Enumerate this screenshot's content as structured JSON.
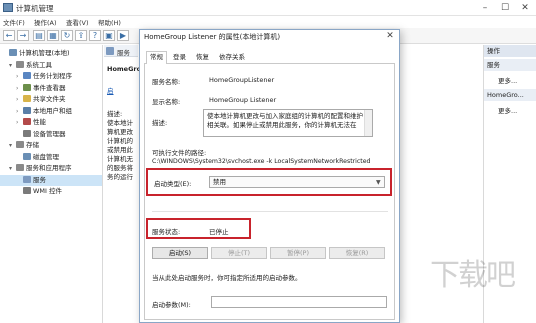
{
  "main": {
    "title": "计算机管理",
    "menu": [
      "文件(F)",
      "操作(A)",
      "查看(V)",
      "帮助(H)"
    ]
  },
  "tree": [
    {
      "label": "计算机管理(本地)",
      "indent": 0,
      "exp": "",
      "icon": "computer-icon",
      "color": "#6a8fb5"
    },
    {
      "label": "系统工具",
      "indent": 1,
      "exp": "▾",
      "icon": "tools-icon",
      "color": "#8a8a8a"
    },
    {
      "label": "任务计划程序",
      "indent": 2,
      "exp": "›",
      "icon": "clock-icon",
      "color": "#5a86c2"
    },
    {
      "label": "事件查看器",
      "indent": 2,
      "exp": "›",
      "icon": "event-viewer-icon",
      "color": "#6c8f4a"
    },
    {
      "label": "共享文件夹",
      "indent": 2,
      "exp": "›",
      "icon": "folder-icon",
      "color": "#d8b44a"
    },
    {
      "label": "本地用户和组",
      "indent": 2,
      "exp": "›",
      "icon": "users-icon",
      "color": "#5a7fa8"
    },
    {
      "label": "性能",
      "indent": 2,
      "exp": "›",
      "icon": "performance-icon",
      "color": "#b34a4a"
    },
    {
      "label": "设备管理器",
      "indent": 2,
      "exp": "",
      "icon": "device-icon",
      "color": "#7a7a7a"
    },
    {
      "label": "存储",
      "indent": 1,
      "exp": "▾",
      "icon": "storage-icon",
      "color": "#8a8a8a"
    },
    {
      "label": "磁盘管理",
      "indent": 2,
      "exp": "",
      "icon": "disk-icon",
      "color": "#6a8fb5"
    },
    {
      "label": "服务和应用程序",
      "indent": 1,
      "exp": "▾",
      "icon": "services-apps-icon",
      "color": "#8a8a8a"
    },
    {
      "label": "服务",
      "indent": 2,
      "exp": "",
      "icon": "gear-icon",
      "color": "#7d9ac0",
      "selected": true
    },
    {
      "label": "WMI 控件",
      "indent": 2,
      "exp": "",
      "icon": "wmi-icon",
      "color": "#7a7a7a"
    }
  ],
  "center": {
    "header": "服务",
    "name1": "HomeGro",
    "link": "启",
    "desc_lines": [
      "描述:",
      "使本地计",
      "算机更改",
      "计算机的",
      "或禁用此",
      "计算机无",
      "的服务将",
      "务的运行"
    ]
  },
  "actions": {
    "header1": "操作",
    "section1": "服务",
    "more1": "更多...",
    "section2": "HomeGro...",
    "more2": "更多..."
  },
  "dialog": {
    "title": "HomeGroup Listener 的属性(本地计算机)",
    "tabs": [
      "常规",
      "登录",
      "恢复",
      "依存关系"
    ],
    "service_name_label": "服务名称:",
    "service_name": "HomeGroupListener",
    "display_name_label": "显示名称:",
    "display_name": "HomeGroup Listener",
    "description_label": "描述:",
    "description": "使本地计算机更改与加入家庭组的计算机的配置和维护相关联。如果停止或禁用此服务，你的计算机无法在",
    "path_label": "可执行文件的路径:",
    "path": "C:\\WINDOWS\\System32\\svchost.exe -k LocalSystemNetworkRestricted",
    "startup_type_label": "启动类型(E):",
    "startup_type": "禁用",
    "status_label": "服务状态:",
    "status": "已停止",
    "buttons": [
      "启动(S)",
      "停止(T)",
      "暂停(P)",
      "恢复(R)"
    ],
    "hint": "当从此处启动服务时，你可指定所适用的启动参数。",
    "param_label": "启动参数(M):"
  },
  "watermark": "下载吧"
}
